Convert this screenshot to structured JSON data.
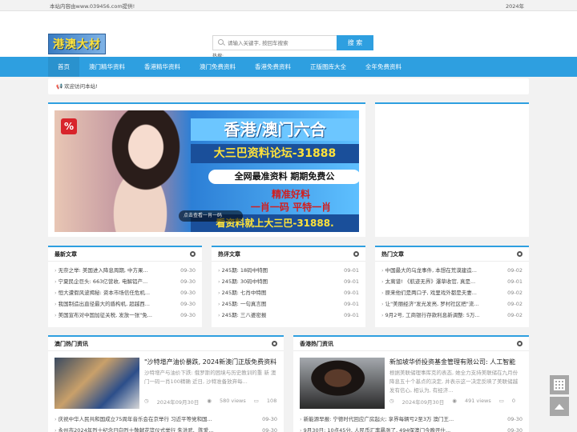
{
  "topbar": {
    "left": "本站内容由www.039456.com提供!",
    "right": "2024年"
  },
  "header": {
    "logo_text": "港澳大材",
    "search_placeholder": "请输入关键字, 按回车搜索",
    "search_button": "搜 索",
    "hot_label": "热搜:"
  },
  "nav": [
    "首页",
    "澳门精华资料",
    "香港精华资料",
    "澳门免费资料",
    "香港免费资料",
    "正版图库大全",
    "全年免费资料"
  ],
  "notice": "欢迎访问本站!",
  "banner": {
    "percent": "%",
    "title": "香港/澳门六合",
    "sub": "大三巴资料论坛-31888",
    "line1": "全网最准资料   期期免费公",
    "red1": "精准好料",
    "red2": "一肖一码   平特一肖",
    "bottom": "看资料就上大三巴-31888.",
    "caption": "点击查看一肖一码"
  },
  "panels": {
    "latest": {
      "title": "最新文章",
      "items": [
        {
          "t": "无奈之举: 美国进入降息周期, 中方果...",
          "d": "09-30"
        },
        {
          "t": "宁夏民企巨头: 663亿营收, 电解铝产...",
          "d": "09-30"
        },
        {
          "t": "恒大遭假风波揭秘: 资本市场信任危机...",
          "d": "09-30"
        },
        {
          "t": "我国制造出直径最大的盾构机, 超越西...",
          "d": "09-30"
        },
        {
          "t": "美国宣布对中国加征关税, 发放一张\"免...",
          "d": "09-30"
        }
      ]
    },
    "hotreview": {
      "title": "热评文章",
      "items": [
        {
          "t": "245期: 18码中特图",
          "d": "09-01"
        },
        {
          "t": "245期: 30码中特图",
          "d": "09-01"
        },
        {
          "t": "245期: 七肖中特图",
          "d": "09-01"
        },
        {
          "t": "245期: 一句真言图",
          "d": "09-01"
        },
        {
          "t": "245期: 三八婆密报",
          "d": "09-01"
        }
      ]
    },
    "hot": {
      "title": "热门文章",
      "items": [
        {
          "t": "中国最大的乌龙事件, 本想在荒漠建造...",
          "d": "09-02"
        },
        {
          "t": "太离谱! 《航迹无界》瀑草收官, 真是...",
          "d": "09-01"
        },
        {
          "t": "原来他们是两口子, 戏里戏外都是夫妻...",
          "d": "09-02"
        },
        {
          "t": "让\"美丽经济\"发光发亮, 罗村社区把\"流...",
          "d": "09-02"
        },
        {
          "t": "9月2号, 工商银行存款利息新调整: 5万...",
          "d": "09-02"
        }
      ]
    },
    "macau": {
      "title": "澳门热门资讯",
      "feat_title": "\"沙特增产油价暴跌, 2024新澳门正版免费资料",
      "feat_sum": "沙特增产与油价下跌: 俄罗斯的困境与历史教训的重 新 澳门一码一肖100精确 近日, 沙特准备放弃每...",
      "feat_date": "2024年09月30日",
      "feat_views": "580 views",
      "feat_comments": "108",
      "items": [
        {
          "t": "庆祝中华人民共和国成立75周年音乐会在京举行 习近平等党和国...",
          "d": "09-30"
        },
        {
          "t": "永州市2024年烈士纪念日向烈士敬献花篮仪式举行 朱洪武、陈爱...",
          "d": "09-30"
        }
      ]
    },
    "hongkong": {
      "title": "香港热门资讯",
      "feat_title": "新加坡华侨投资基金管理有限公司: 人工智能",
      "feat_sum": "根据美联储理事库克的表态, 她全力支持美联储在九月份降息五十个基点的决定, 并表示这一决定反映了美联储越发有信心, 相认为, 有经济...",
      "feat_date": "2024年09月30日",
      "feat_views": "491 views",
      "feat_comments": "0",
      "items": [
        {
          "t": "新能源早报: 宁德时代回应广房起火; 享界每辆亏2至3万 澳门王...",
          "d": "09-30"
        },
        {
          "t": "9月30日: 10点45分, 人民币汇率暴涨了, 494保澳门今晚开什...",
          "d": "09-30"
        }
      ]
    }
  },
  "float": {
    "qr_icon": "qr-code-icon",
    "top_icon": "arrow-up-icon"
  }
}
